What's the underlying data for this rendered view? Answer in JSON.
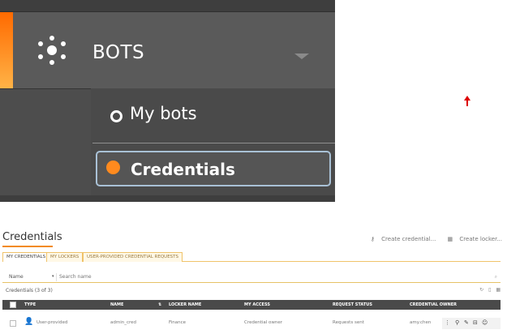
{
  "nav": {
    "bots_label": "BOTS",
    "items": [
      {
        "label": "My bots"
      },
      {
        "label": "Credentials"
      }
    ]
  },
  "page": {
    "title": "Credentials",
    "actions": {
      "create_credential": "Create credential...",
      "create_locker": "Create locker..."
    },
    "tabs": [
      "MY CREDENTIALS",
      "MY LOCKERS",
      "USER-PROVIDED CREDENTIAL REQUESTS"
    ],
    "search": {
      "field": "Name",
      "placeholder": "Search name"
    },
    "count_text": "Credentials (3 of 3)",
    "columns": [
      "TYPE",
      "NAME",
      "LOCKER NAME",
      "MY ACCESS",
      "REQUEST STATUS",
      "CREDENTIAL OWNER"
    ],
    "rows": [
      {
        "type": "User-provided",
        "name": "admin_cred",
        "locker": "Finance",
        "access": "Credential owner",
        "status": "Requests sent",
        "owner": "amy.chen"
      }
    ]
  },
  "colors": {
    "accent": "#f28a1a",
    "sidebar_bg": "#4d4d4d",
    "selected_border": "#a9c1d6",
    "arrow": "#dd0000"
  }
}
